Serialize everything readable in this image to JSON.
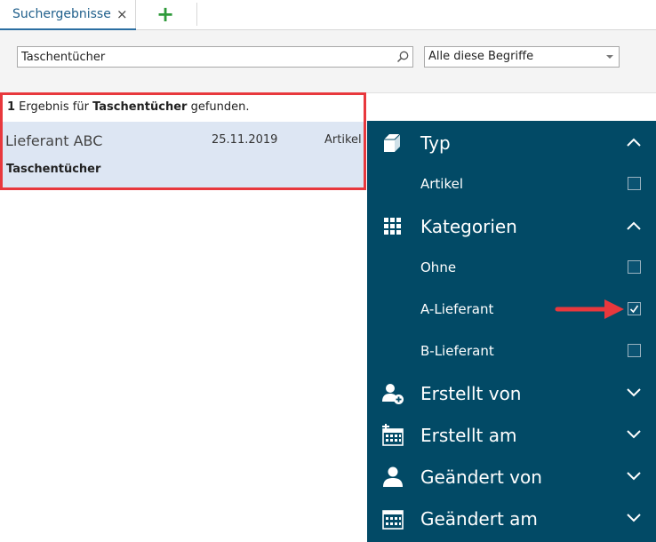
{
  "tabs": {
    "active_label": "Suchergebnisse",
    "close_glyph": "×",
    "add_glyph": "+"
  },
  "search": {
    "query": "Taschentücher",
    "mode_selected": "Alle diese Begriffe"
  },
  "results": {
    "count": "1",
    "summary_pre": " Ergebnis für ",
    "summary_term": "Taschentücher",
    "summary_post": " gefunden.",
    "items": [
      {
        "supplier": "Lieferant ABC",
        "date": "25.11.2019",
        "type": "Artikel",
        "title": "Taschentücher"
      }
    ]
  },
  "facets": {
    "typ": {
      "title": "Typ",
      "expanded": true,
      "options": [
        {
          "label": "Artikel",
          "checked": false
        }
      ]
    },
    "kategorien": {
      "title": "Kategorien",
      "expanded": true,
      "options": [
        {
          "label": "Ohne",
          "checked": false
        },
        {
          "label": "A-Lieferant",
          "checked": true
        },
        {
          "label": "B-Lieferant",
          "checked": false
        }
      ]
    },
    "erstellt_von": {
      "title": "Erstellt von",
      "expanded": false
    },
    "erstellt_am": {
      "title": "Erstellt am",
      "expanded": false
    },
    "geaendert_von": {
      "title": "Geändert von",
      "expanded": false
    },
    "geaendert_am": {
      "title": "Geändert am",
      "expanded": false
    }
  },
  "icons": {
    "typ": "box-icon",
    "kategorien": "grid-icon",
    "erstellt_von": "user-add-icon",
    "erstellt_am": "calendar-add-icon",
    "geaendert_von": "user-icon",
    "geaendert_am": "calendar-icon"
  },
  "colors": {
    "panel": "#024a66",
    "accent_tab": "#2b6ea2",
    "highlight": "#e8383d",
    "result_row": "#dde6f3",
    "add_button": "#2e9a3a"
  }
}
